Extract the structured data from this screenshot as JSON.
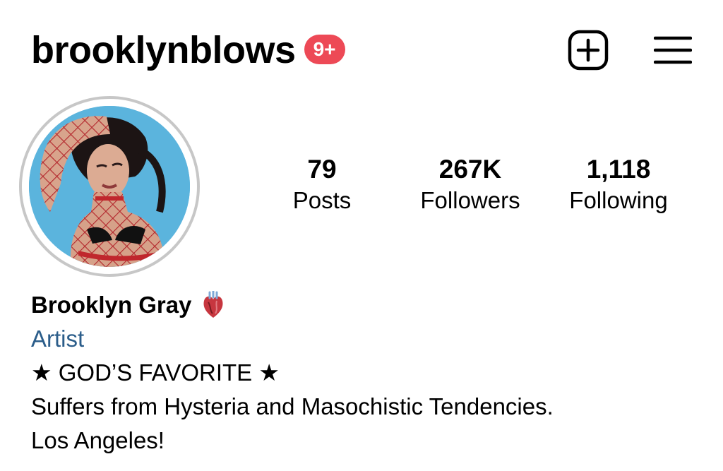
{
  "header": {
    "username": "brooklynblows",
    "notification_badge": "9+",
    "badge_color": "#ed4956",
    "new_post_icon": "plus-square-icon",
    "menu_icon": "hamburger-menu-icon"
  },
  "profile": {
    "avatar_alt": "profile-photo",
    "ring_color": "#c7c7c7"
  },
  "stats": [
    {
      "count": "79",
      "label": "Posts"
    },
    {
      "count": "267K",
      "label": "Followers"
    },
    {
      "count": "1,118",
      "label": "Following"
    }
  ],
  "bio": {
    "full_name": "Brooklyn Gray",
    "name_emoji_icon": "anatomical-heart-icon",
    "category": "Artist",
    "category_color": "#2b5d8a",
    "lines": [
      "★ GOD’S FAVORITE ★",
      "Suffers from Hysteria and Masochistic Tendencies.",
      "Los Angeles!"
    ]
  }
}
